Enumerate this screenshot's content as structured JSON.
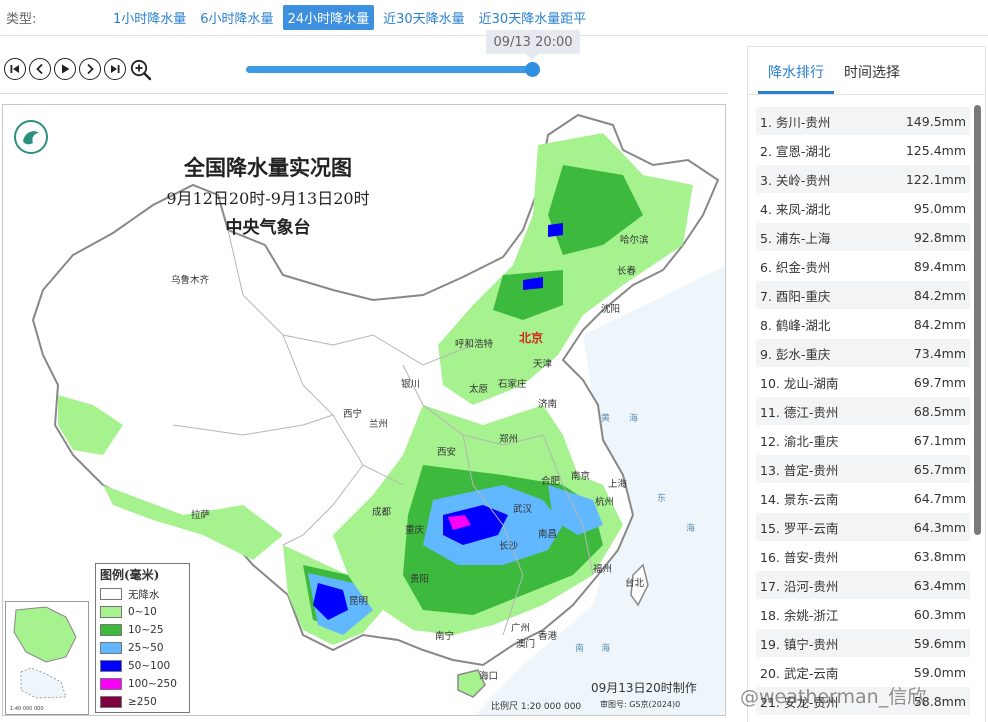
{
  "typebar": {
    "label": "类型:",
    "tabs": [
      {
        "label": "1小时降水量",
        "active": false
      },
      {
        "label": "6小时降水量",
        "active": false
      },
      {
        "label": "24小时降水量",
        "active": true
      },
      {
        "label": "近30天降水量",
        "active": false
      },
      {
        "label": "近30天降水量距平",
        "active": false
      }
    ]
  },
  "player": {
    "current_time": "09/13 20:00",
    "progress_fraction": 0.985,
    "buttons": [
      "first-frame-icon",
      "prev-frame-icon",
      "play-icon",
      "next-frame-icon",
      "last-frame-icon",
      "zoom-in-icon"
    ]
  },
  "map": {
    "title": "全国降水量实况图",
    "subtitle": "9月12日20时-9月13日20时",
    "issuer": "中央气象台",
    "capital": "北京",
    "cities": [
      "哈尔滨",
      "长春",
      "沈阳",
      "乌鲁木齐",
      "呼和浩特",
      "天津",
      "银川",
      "太原",
      "石家庄",
      "西宁",
      "兰州",
      "济南",
      "郑州",
      "西安",
      "合肥",
      "南京",
      "上海",
      "杭州",
      "拉萨",
      "成都",
      "武汉",
      "重庆",
      "南昌",
      "长沙",
      "福州",
      "台北",
      "贵阳",
      "昆明",
      "南宁",
      "广州",
      "澳门",
      "香港",
      "海口"
    ],
    "seas": [
      "东",
      "海",
      "黄",
      "海",
      "南",
      "海"
    ],
    "legend": {
      "title": "图例(毫米)",
      "items": [
        {
          "label": "无降水",
          "color": "#ffffff"
        },
        {
          "label": "0~10",
          "color": "#a6f28f"
        },
        {
          "label": "10~25",
          "color": "#3dba3d"
        },
        {
          "label": "25~50",
          "color": "#61b8ff"
        },
        {
          "label": "50~100",
          "color": "#0000ff"
        },
        {
          "label": "100~250",
          "color": "#fa00fa"
        },
        {
          "label": "≥250",
          "color": "#800040"
        }
      ]
    },
    "inset_scale": "1:40 000 000",
    "made_note": "09月13日20时制作",
    "scale_note": "比例尺 1:20 000 000",
    "approval_note": "审图号: GS京(2024)0"
  },
  "watermark": "@weatherman_信欣",
  "ranking": {
    "tabs": [
      {
        "label": "降水排行",
        "active": true
      },
      {
        "label": "时间选择",
        "active": false
      }
    ],
    "rows": [
      {
        "name": "1. 务川-贵州",
        "value": "149.5mm"
      },
      {
        "name": "2. 宣恩-湖北",
        "value": "125.4mm"
      },
      {
        "name": "3. 关岭-贵州",
        "value": "122.1mm"
      },
      {
        "name": "4. 来凤-湖北",
        "value": "95.0mm"
      },
      {
        "name": "5. 浦东-上海",
        "value": "92.8mm"
      },
      {
        "name": "6. 织金-贵州",
        "value": "89.4mm"
      },
      {
        "name": "7. 酉阳-重庆",
        "value": "84.2mm"
      },
      {
        "name": "8. 鹤峰-湖北",
        "value": "84.2mm"
      },
      {
        "name": "9. 彭水-重庆",
        "value": "73.4mm"
      },
      {
        "name": "10. 龙山-湖南",
        "value": "69.7mm"
      },
      {
        "name": "11. 德江-贵州",
        "value": "68.5mm"
      },
      {
        "name": "12. 渝北-重庆",
        "value": "67.1mm"
      },
      {
        "name": "13. 普定-贵州",
        "value": "65.7mm"
      },
      {
        "name": "14. 景东-云南",
        "value": "64.7mm"
      },
      {
        "name": "15. 罗平-云南",
        "value": "64.3mm"
      },
      {
        "name": "16. 普安-贵州",
        "value": "63.8mm"
      },
      {
        "name": "17. 沿河-贵州",
        "value": "63.4mm"
      },
      {
        "name": "18. 余姚-浙江",
        "value": "60.3mm"
      },
      {
        "name": "19. 镇宁-贵州",
        "value": "59.6mm"
      },
      {
        "name": "20. 武定-云南",
        "value": "59.0mm"
      },
      {
        "name": "21. 安龙-贵州",
        "value": "58.8mm"
      }
    ]
  }
}
